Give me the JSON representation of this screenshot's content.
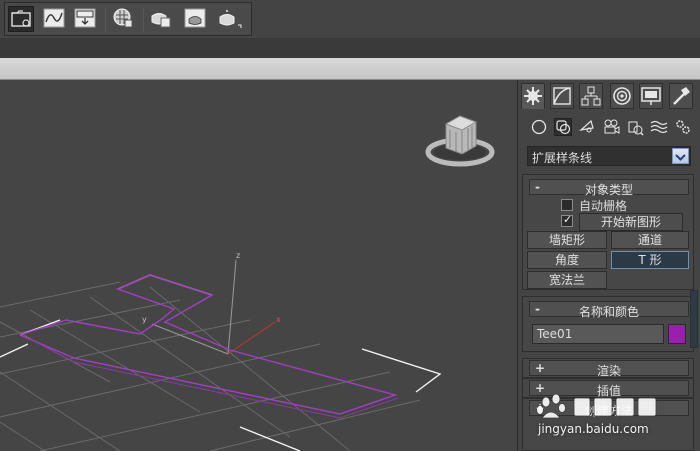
{
  "colors": {
    "accent_purple": "#9a1fb0",
    "viewport_bg": "#454545",
    "panel_bg": "#444444",
    "shape_line": "#a040c0"
  },
  "toolbar": {
    "icons": [
      "open-file-icon",
      "curve-editor-icon",
      "save-icon",
      "material-icon",
      "render-setup-icon",
      "render-frame-icon",
      "render-icon"
    ]
  },
  "viewport": {
    "axis_x": "x",
    "axis_y": "y",
    "axis_z": "z"
  },
  "panel": {
    "tabs": [
      "create-tab",
      "modify-tab",
      "hierarchy-tab",
      "motion-tab",
      "display-tab",
      "utilities-tab"
    ],
    "subcategories": [
      "geometry-icon",
      "shapes-icon",
      "lights-icon",
      "cameras-icon",
      "helpers-icon",
      "space-warps-icon",
      "systems-icon"
    ],
    "category_dropdown": "扩展样条线",
    "object_type": {
      "title": "对象类型",
      "sign": "-",
      "autogrid_label": "自动栅格",
      "start_new_shape_label": "开始新图形",
      "start_new_shape_check": "✓",
      "buttons": [
        "墙矩形",
        "通道",
        "角度",
        "T 形",
        "宽法兰"
      ]
    },
    "name_color": {
      "title": "名称和颜色",
      "sign": "-",
      "name_value": "Tee01"
    },
    "render": {
      "title": "渲染",
      "sign": "+"
    },
    "interpolation": {
      "title": "插值",
      "sign": "+"
    },
    "creation_method": {
      "title": "创建方法",
      "sign": "+"
    }
  },
  "watermark": {
    "url": "jingyan.baidu.com"
  }
}
